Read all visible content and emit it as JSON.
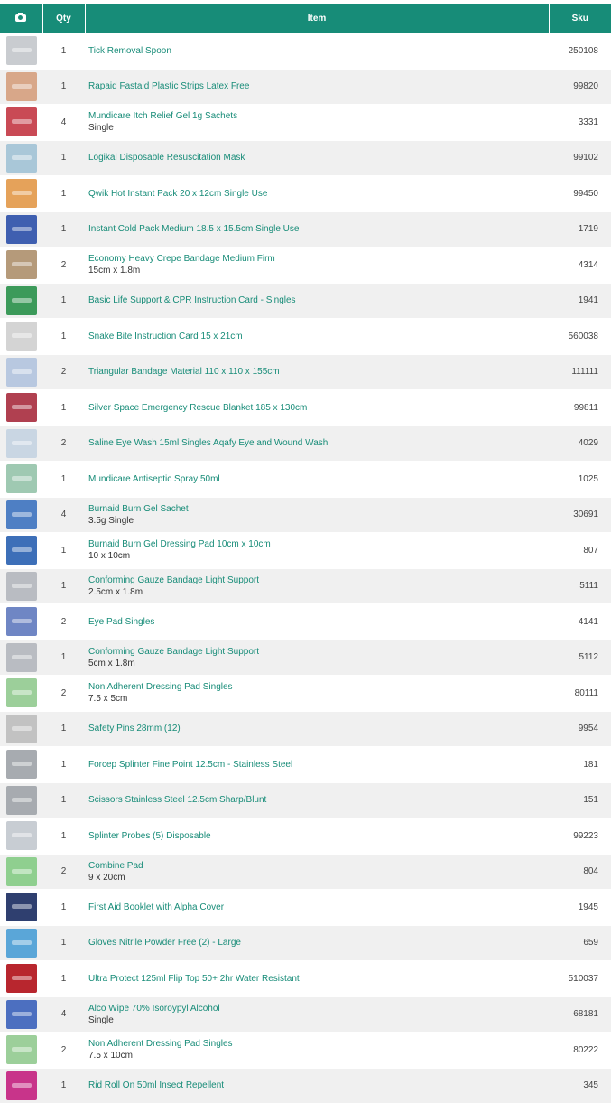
{
  "header": {
    "photo_icon": "camera-icon",
    "qty": "Qty",
    "item": "Item",
    "sku": "Sku"
  },
  "colors": {
    "header": "#178c78",
    "link": "#178c78",
    "row_alt": "#f0f0f0"
  },
  "items": [
    {
      "qty": "1",
      "name": "Tick Removal Spoon",
      "variant": "",
      "sku": "250108",
      "thumb": "#c9ccd0"
    },
    {
      "qty": "1",
      "name": "Rapaid Fastaid Plastic Strips Latex Free",
      "variant": "",
      "sku": "99820",
      "thumb": "#d8a789"
    },
    {
      "qty": "4",
      "name": "Mundicare Itch Relief Gel 1g Sachets",
      "variant": "Single",
      "sku": "3331",
      "thumb": "#c94a55"
    },
    {
      "qty": "1",
      "name": "Logikal Disposable Resuscitation Mask",
      "variant": "",
      "sku": "99102",
      "thumb": "#a9c7d8"
    },
    {
      "qty": "1",
      "name": "Qwik Hot Instant Pack 20 x 12cm Single Use",
      "variant": "",
      "sku": "99450",
      "thumb": "#e5a25a"
    },
    {
      "qty": "1",
      "name": "Instant Cold Pack Medium 18.5 x 15.5cm Single Use",
      "variant": "",
      "sku": "1719",
      "thumb": "#3f5fb0"
    },
    {
      "qty": "2",
      "name": "Economy Heavy Crepe Bandage Medium Firm",
      "variant": "15cm x 1.8m",
      "sku": "4314",
      "thumb": "#b59a7a"
    },
    {
      "qty": "1",
      "name": "Basic Life Support & CPR Instruction Card - Singles",
      "variant": "",
      "sku": "1941",
      "thumb": "#3c9a5a"
    },
    {
      "qty": "1",
      "name": "Snake Bite Instruction Card 15 x 21cm",
      "variant": "",
      "sku": "560038",
      "thumb": "#d4d4d4"
    },
    {
      "qty": "2",
      "name": "Triangular Bandage Material 110 x 110 x 155cm",
      "variant": "",
      "sku": "111111",
      "thumb": "#b8c8e0"
    },
    {
      "qty": "1",
      "name": "Silver Space Emergency Rescue Blanket 185 x 130cm",
      "variant": "",
      "sku": "99811",
      "thumb": "#b04050"
    },
    {
      "qty": "2",
      "name": "Saline Eye Wash 15ml Singles Aqafy Eye and Wound Wash",
      "variant": "",
      "sku": "4029",
      "thumb": "#c9d6e3"
    },
    {
      "qty": "1",
      "name": "Mundicare Antiseptic Spray 50ml",
      "variant": "",
      "sku": "1025",
      "thumb": "#9fc9b2"
    },
    {
      "qty": "4",
      "name": "Burnaid Burn Gel Sachet",
      "variant": "3.5g Single",
      "sku": "30691",
      "thumb": "#4e7fc4"
    },
    {
      "qty": "1",
      "name": "Burnaid Burn Gel Dressing Pad 10cm x 10cm",
      "variant": "10 x 10cm",
      "sku": "807",
      "thumb": "#3d6fb8"
    },
    {
      "qty": "1",
      "name": "Conforming Gauze Bandage Light Support",
      "variant": "2.5cm x 1.8m",
      "sku": "5111",
      "thumb": "#b9bcc2"
    },
    {
      "qty": "2",
      "name": "Eye Pad Singles",
      "variant": "",
      "sku": "4141",
      "thumb": "#6f86c4"
    },
    {
      "qty": "1",
      "name": "Conforming Gauze Bandage Light Support",
      "variant": "5cm x 1.8m",
      "sku": "5112",
      "thumb": "#b9bcc2"
    },
    {
      "qty": "2",
      "name": "Non Adherent Dressing Pad Singles",
      "variant": "7.5 x 5cm",
      "sku": "80111",
      "thumb": "#9ccf9a"
    },
    {
      "qty": "1",
      "name": "Safety Pins 28mm (12)",
      "variant": "",
      "sku": "9954",
      "thumb": "#c2c2c2"
    },
    {
      "qty": "1",
      "name": "Forcep Splinter Fine Point 12.5cm - Stainless Steel",
      "variant": "",
      "sku": "181",
      "thumb": "#a7abb0"
    },
    {
      "qty": "1",
      "name": "Scissors Stainless Steel 12.5cm Sharp/Blunt",
      "variant": "",
      "sku": "151",
      "thumb": "#a7abb0"
    },
    {
      "qty": "1",
      "name": "Splinter Probes (5) Disposable",
      "variant": "",
      "sku": "99223",
      "thumb": "#c8cdd3"
    },
    {
      "qty": "2",
      "name": "Combine Pad",
      "variant": "9 x 20cm",
      "sku": "804",
      "thumb": "#8fcf8f"
    },
    {
      "qty": "1",
      "name": "First Aid Booklet with Alpha Cover",
      "variant": "",
      "sku": "1945",
      "thumb": "#2f3f6f"
    },
    {
      "qty": "1",
      "name": "Gloves Nitrile Powder Free (2) - Large",
      "variant": "",
      "sku": "659",
      "thumb": "#5aa6d8"
    },
    {
      "qty": "1",
      "name": "Ultra Protect 125ml Flip Top 50+ 2hr Water Resistant",
      "variant": "",
      "sku": "510037",
      "thumb": "#b8262e"
    },
    {
      "qty": "4",
      "name": "Alco Wipe 70% Isoroypyl Alcohol",
      "variant": "Single",
      "sku": "68181",
      "thumb": "#4c6fc0"
    },
    {
      "qty": "2",
      "name": "Non Adherent Dressing Pad Singles",
      "variant": "7.5 x 10cm",
      "sku": "80222",
      "thumb": "#9ccf9a"
    },
    {
      "qty": "1",
      "name": "Rid Roll On 50ml Insect Repellent",
      "variant": "",
      "sku": "345",
      "thumb": "#c8348a"
    }
  ]
}
